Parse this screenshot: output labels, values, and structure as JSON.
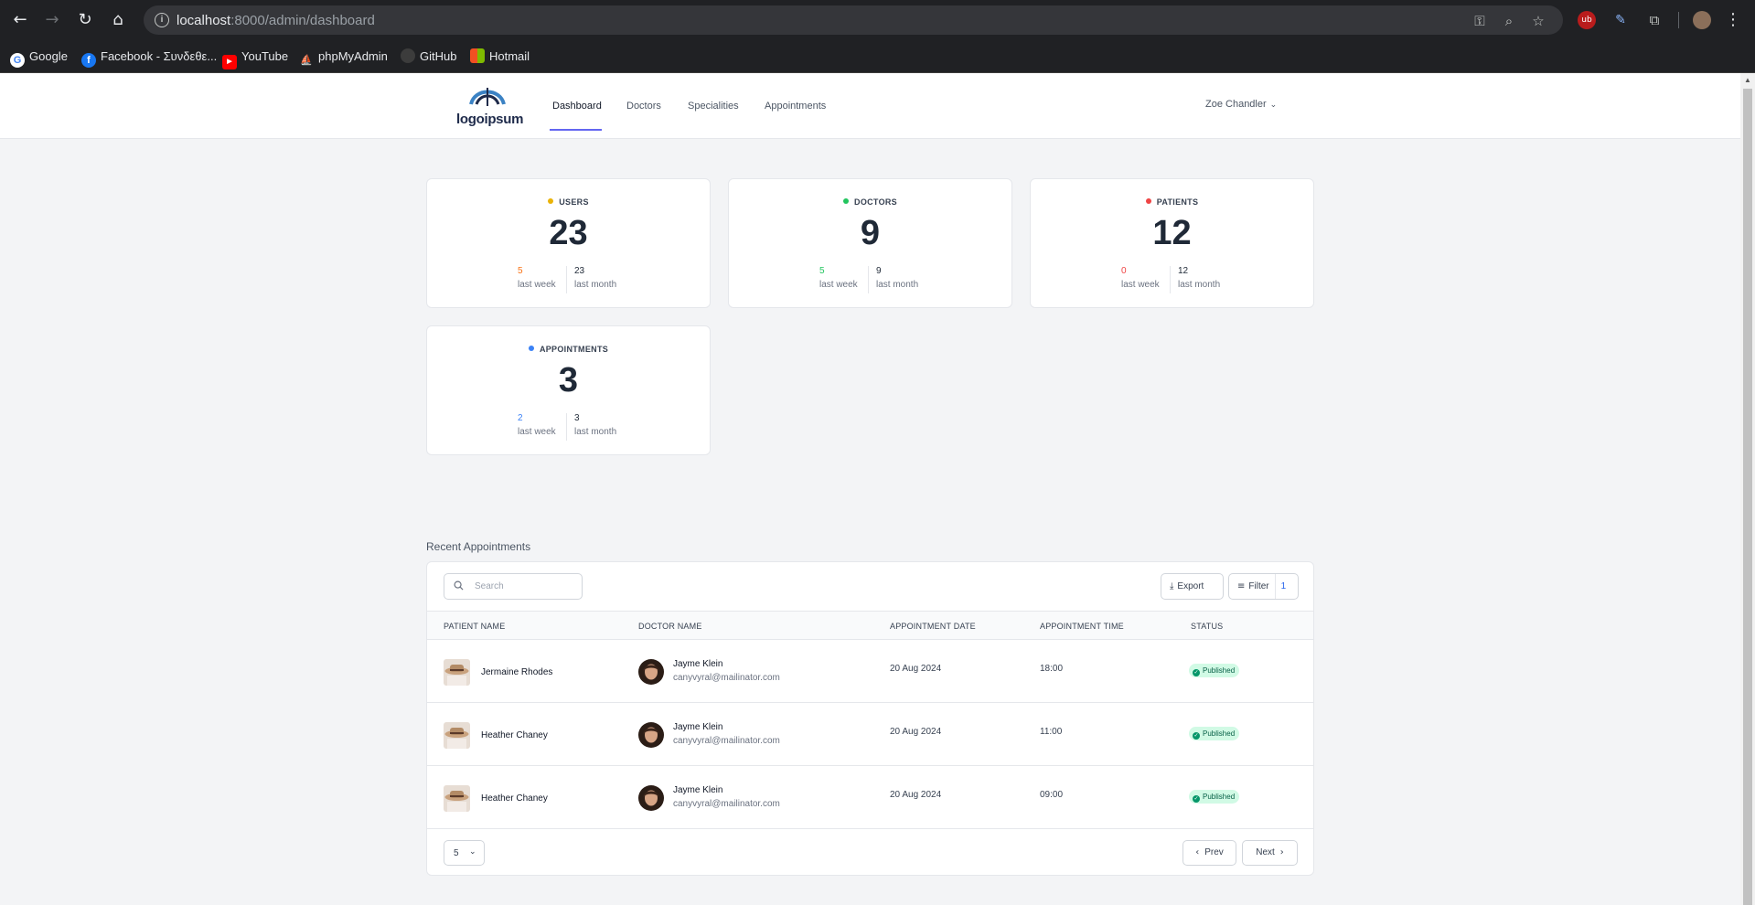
{
  "browser": {
    "url_host": "localhost",
    "url_path": ":8000/admin/dashboard",
    "bookmarks": [
      "Google",
      "Facebook - Συνδεθε...",
      "YouTube",
      "phpMyAdmin",
      "GitHub",
      "Hotmail"
    ]
  },
  "header": {
    "logo_text": "logoipsum",
    "nav": [
      "Dashboard",
      "Doctors",
      "Specialities",
      "Appointments"
    ],
    "active_nav": "Dashboard",
    "user_name": "Zoe Chandler"
  },
  "stats": [
    {
      "label": "USERS",
      "dot_color": "#eab308",
      "value": "23",
      "last_week": "5",
      "last_week_color": "#f97316",
      "last_month": "23",
      "week_text": "last week",
      "month_text": "last month"
    },
    {
      "label": "DOCTORS",
      "dot_color": "#22c55e",
      "value": "9",
      "last_week": "5",
      "last_week_color": "#22c55e",
      "last_month": "9",
      "week_text": "last week",
      "month_text": "last month"
    },
    {
      "label": "PATIENTS",
      "dot_color": "#ef4444",
      "value": "12",
      "last_week": "0",
      "last_week_color": "#ef4444",
      "last_month": "12",
      "week_text": "last week",
      "month_text": "last month"
    },
    {
      "label": "APPOINTMENTS",
      "dot_color": "#3b82f6",
      "value": "3",
      "last_week": "2",
      "last_week_color": "#3b82f6",
      "last_month": "3",
      "week_text": "last week",
      "month_text": "last month"
    }
  ],
  "recent": {
    "title": "Recent Appointments",
    "search_placeholder": "Search",
    "export_label": "Export",
    "filter_label": "Filter",
    "filter_count": "1",
    "columns": [
      "PATIENT NAME",
      "DOCTOR NAME",
      "APPOINTMENT DATE",
      "APPOINTMENT TIME",
      "STATUS"
    ],
    "rows": [
      {
        "patient": "Jermaine Rhodes",
        "doctor": "Jayme Klein",
        "email": "canyvyral@mailinator.com",
        "date": "20 Aug 2024",
        "time": "18:00",
        "status": "Published"
      },
      {
        "patient": "Heather Chaney",
        "doctor": "Jayme Klein",
        "email": "canyvyral@mailinator.com",
        "date": "20 Aug 2024",
        "time": "11:00",
        "status": "Published"
      },
      {
        "patient": "Heather Chaney",
        "doctor": "Jayme Klein",
        "email": "canyvyral@mailinator.com",
        "date": "20 Aug 2024",
        "time": "09:00",
        "status": "Published"
      }
    ],
    "per_page": "5",
    "prev_label": "Prev",
    "next_label": "Next"
  }
}
